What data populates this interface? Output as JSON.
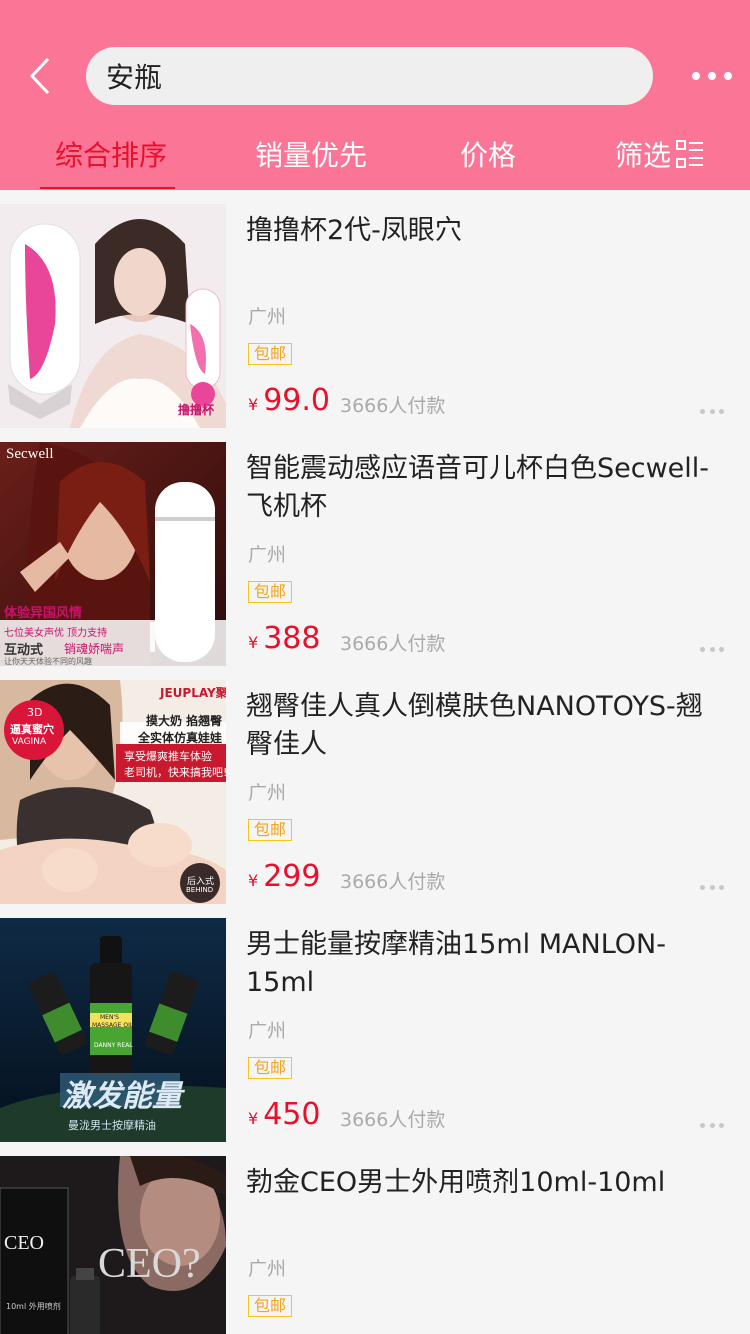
{
  "header": {
    "back_icon": "chevron-left-icon",
    "search_value": "安瓶",
    "more_icon": "more-dots-icon",
    "background": "#fb7596"
  },
  "tabs": [
    {
      "label": "综合排序",
      "active": true
    },
    {
      "label": "销量优先",
      "active": false
    },
    {
      "label": "价格",
      "active": false
    },
    {
      "label": "筛选",
      "active": false,
      "icon": "filter-list-icon"
    }
  ],
  "accent_color": "#e8102a",
  "products": [
    {
      "title": "撸撸杯2代-凤眼穴",
      "city": "广州",
      "tag": "包邮",
      "currency": "¥",
      "price": "99.0",
      "paid": "3666人付款",
      "image_text": [
        "撸撸杯"
      ]
    },
    {
      "title": "智能震动感应语音可儿杯白色Secwell-飞机杯",
      "city": "广州",
      "tag": "包邮",
      "currency": "¥",
      "price": "388",
      "paid": "3666人付款",
      "image_text": [
        "Secwell",
        "体验异国风情",
        "七位美女声优 顶力支持",
        "互动式",
        "销魂娇喘声",
        "让你天天体验不同的风趣"
      ]
    },
    {
      "title": "翘臀佳人真人倒模肤色NANOTOYS-翘臀佳人",
      "city": "广州",
      "tag": "包邮",
      "currency": "¥",
      "price": "299",
      "paid": "3666人付款",
      "image_text": [
        "JEUPLAY聚品",
        "3D",
        "逼真蜜穴",
        "VAGINA",
        "摸大奶 掐翘臀",
        "全实体仿真娃娃",
        "享受爆爽推车体验",
        "老司机，快来搞我吧!",
        "后入式",
        "BEHIND"
      ]
    },
    {
      "title": "男士能量按摩精油15ml MANLON-15ml",
      "city": "广州",
      "tag": "包邮",
      "currency": "¥",
      "price": "450",
      "paid": "3666人付款",
      "image_text": [
        "MEN'S",
        "MASSAGE OIL",
        "DANNY REAL",
        "激发能量",
        "曼泷男士按摩精油"
      ]
    },
    {
      "title": "勃金CEO男士外用喷剂10ml-10ml",
      "city": "广州",
      "tag": "包邮",
      "currency": "¥",
      "price": "",
      "paid": "",
      "image_text": [
        "CEO",
        "CEO?",
        "10ml 外用喷剂"
      ]
    }
  ]
}
